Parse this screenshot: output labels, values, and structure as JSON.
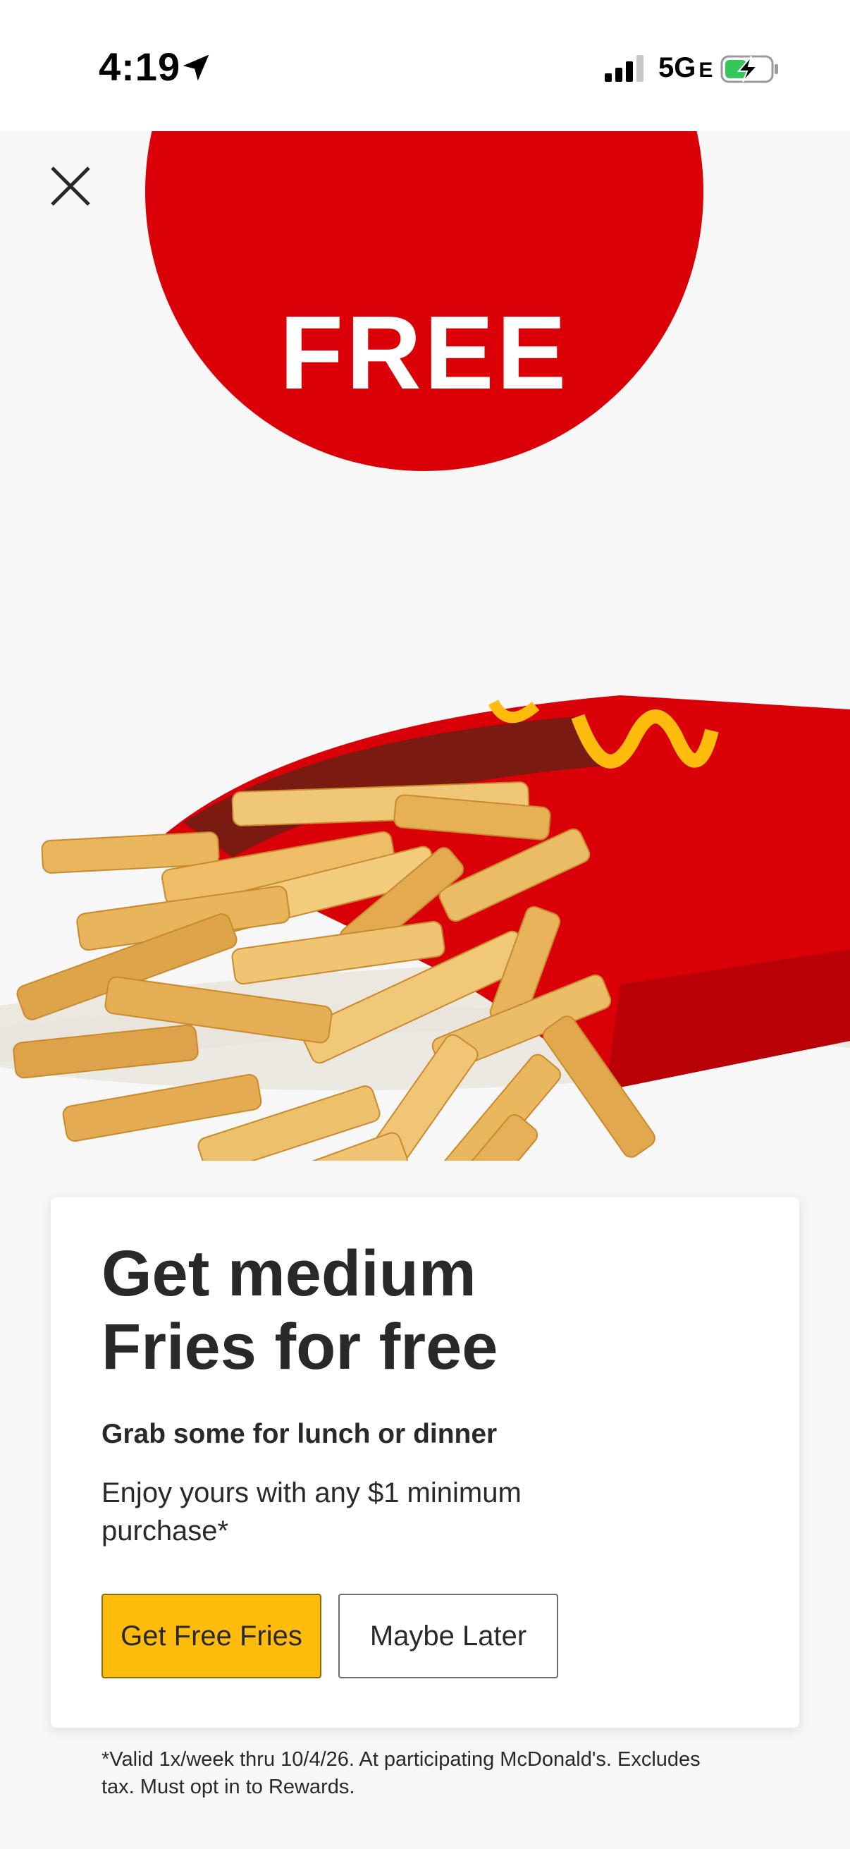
{
  "status_bar": {
    "time": "4:19",
    "network": "5G",
    "network_suffix": "E",
    "icons": [
      "location-arrow-icon",
      "signal-icon",
      "battery-charging-icon"
    ]
  },
  "hero": {
    "badge_text": "FREE",
    "close_icon": "close-icon",
    "image": "medium-fries-carton",
    "colors": {
      "badge": "#db0007",
      "carton": "#d90007",
      "arches": "#ffbc0d"
    }
  },
  "offer": {
    "title": "Get medium Fries for free",
    "subtitle": "Grab some for lunch or dinner",
    "body": "Enjoy yours with any $1 minimum purchase*",
    "primary_button": "Get Free Fries",
    "secondary_button": "Maybe Later",
    "colors": {
      "primary": "#ffbc0d"
    }
  },
  "disclaimer": "*Valid 1x/week thru 10/4/26. At participating McDonald's. Excludes tax. Must opt in to Rewards."
}
